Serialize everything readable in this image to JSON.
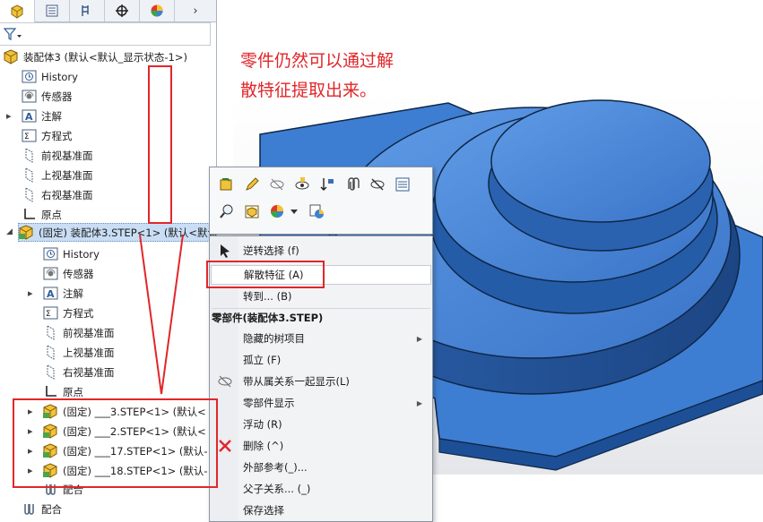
{
  "panel_tabs": [
    {
      "name": "feature-manager-tab-icon",
      "active": true
    },
    {
      "name": "property-manager-tab-icon",
      "active": false
    },
    {
      "name": "configuration-manager-tab-icon",
      "active": false
    },
    {
      "name": "dimxpert-tab-icon",
      "active": false
    },
    {
      "name": "display-manager-tab-icon",
      "active": false
    }
  ],
  "tree": {
    "root_label": "装配体3  (默认<默认_显示状态-1>)",
    "top_items": [
      {
        "label": "History",
        "icon": "history-icon"
      },
      {
        "label": "传感器",
        "icon": "sensor-icon"
      },
      {
        "label": "注解",
        "icon": "annotation-icon",
        "expandable": true
      },
      {
        "label": "方程式",
        "icon": "equation-icon"
      },
      {
        "label": "前视基准面",
        "icon": "plane-icon"
      },
      {
        "label": "上视基准面",
        "icon": "plane-icon"
      },
      {
        "label": "右视基准面",
        "icon": "plane-icon"
      },
      {
        "label": "原点",
        "icon": "origin-icon"
      }
    ],
    "sub_assembly_label": "(固定) 装配体3.STEP<1> (默认<默认",
    "sub_items": [
      {
        "label": "History",
        "icon": "history-icon"
      },
      {
        "label": "传感器",
        "icon": "sensor-icon"
      },
      {
        "label": "注解",
        "icon": "annotation-icon",
        "expandable": true
      },
      {
        "label": "方程式",
        "icon": "equation-icon"
      },
      {
        "label": "前视基准面",
        "icon": "plane-icon"
      },
      {
        "label": "上视基准面",
        "icon": "plane-icon"
      },
      {
        "label": "右视基准面",
        "icon": "plane-icon"
      },
      {
        "label": "原点",
        "icon": "origin-icon"
      }
    ],
    "parts": [
      {
        "label": "(固定) ___3.STEP<1> (默认<"
      },
      {
        "label": "(固定) ___2.STEP<1> (默认<"
      },
      {
        "label": "(固定) ___17.STEP<1> (默认-"
      },
      {
        "label": "(固定) ___18.STEP<1> (默认-"
      }
    ],
    "mates_label": "配合",
    "mates_label2": "配合"
  },
  "note_lines": [
    "零件仍然可以通过解",
    "散特征提取出来。"
  ],
  "context_toolbar": {
    "row1": [
      "open-part-icon",
      "edit-part-icon",
      "hide-icon",
      "change-transparency-icon",
      "sort-order-icon",
      "attachment-icon",
      "suppress-icon",
      "properties-icon"
    ],
    "row2": [
      "zoom-to-selection-icon",
      "component-properties-icon",
      "appearance-icon",
      "dropdown-arrow-icon",
      "assembly-transparency-icon"
    ]
  },
  "context_menu": {
    "items_top": [
      {
        "label": "逆转选择 (f)",
        "icon": "cursor-icon"
      },
      {
        "label": "解散特征 (A)",
        "highlighted": true
      },
      {
        "label": "转到... (B)"
      }
    ],
    "section_title": "零部件(装配体3.STEP)",
    "items_section": [
      {
        "label": "隐藏的树项目",
        "submenu": true
      },
      {
        "label": "孤立 (F)"
      },
      {
        "label": "带从属关系一起显示(L)",
        "icon": "hide-dependents-icon"
      },
      {
        "label": "零部件显示",
        "submenu": true
      },
      {
        "label": "浮动 (R)"
      },
      {
        "label": "删除 (^)",
        "icon": "delete-x-icon"
      },
      {
        "label": "外部参考(_)..."
      },
      {
        "label": "父子关系... (_)"
      },
      {
        "label": "保存选择"
      }
    ]
  },
  "colors": {
    "annotation_red": "#e2262a",
    "model_blue": "#3b7fd6",
    "selection_blue": "#c9def5"
  }
}
